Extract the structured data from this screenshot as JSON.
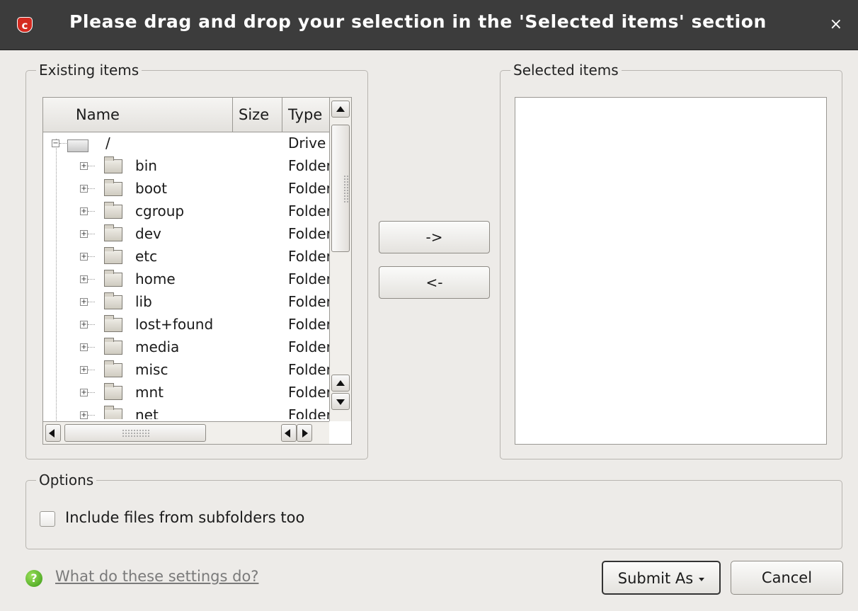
{
  "dialog": {
    "title": "Please drag and drop your selection in the 'Selected items' section",
    "close_label": "×",
    "logo_letter": "c"
  },
  "existing": {
    "legend": "Existing items",
    "columns": {
      "name": "Name",
      "size": "Size",
      "type": "Type"
    },
    "root": {
      "name": "/",
      "type": "Drive",
      "expander": "−"
    },
    "rows": [
      {
        "name": "bin",
        "type": "Folder",
        "expander": "+"
      },
      {
        "name": "boot",
        "type": "Folder",
        "expander": "+"
      },
      {
        "name": "cgroup",
        "type": "Folder",
        "expander": "+"
      },
      {
        "name": "dev",
        "type": "Folder",
        "expander": "+"
      },
      {
        "name": "etc",
        "type": "Folder",
        "expander": "+"
      },
      {
        "name": "home",
        "type": "Folder",
        "expander": "+"
      },
      {
        "name": "lib",
        "type": "Folder",
        "expander": "+"
      },
      {
        "name": "lost+found",
        "type": "Folder",
        "expander": "+"
      },
      {
        "name": "media",
        "type": "Folder",
        "expander": "+"
      },
      {
        "name": "misc",
        "type": "Folder",
        "expander": "+"
      },
      {
        "name": "mnt",
        "type": "Folder",
        "expander": "+"
      },
      {
        "name": "net",
        "type": "Folder",
        "expander": "+"
      }
    ]
  },
  "move": {
    "add_label": "->",
    "remove_label": "<-"
  },
  "selected": {
    "legend": "Selected items"
  },
  "options": {
    "legend": "Options",
    "include_subfolders_label": "Include files from subfolders too",
    "include_subfolders_checked": false
  },
  "footer": {
    "help_icon_glyph": "?",
    "help_link": "What do these settings do?",
    "submit_label": "Submit As",
    "cancel_label": "Cancel"
  }
}
